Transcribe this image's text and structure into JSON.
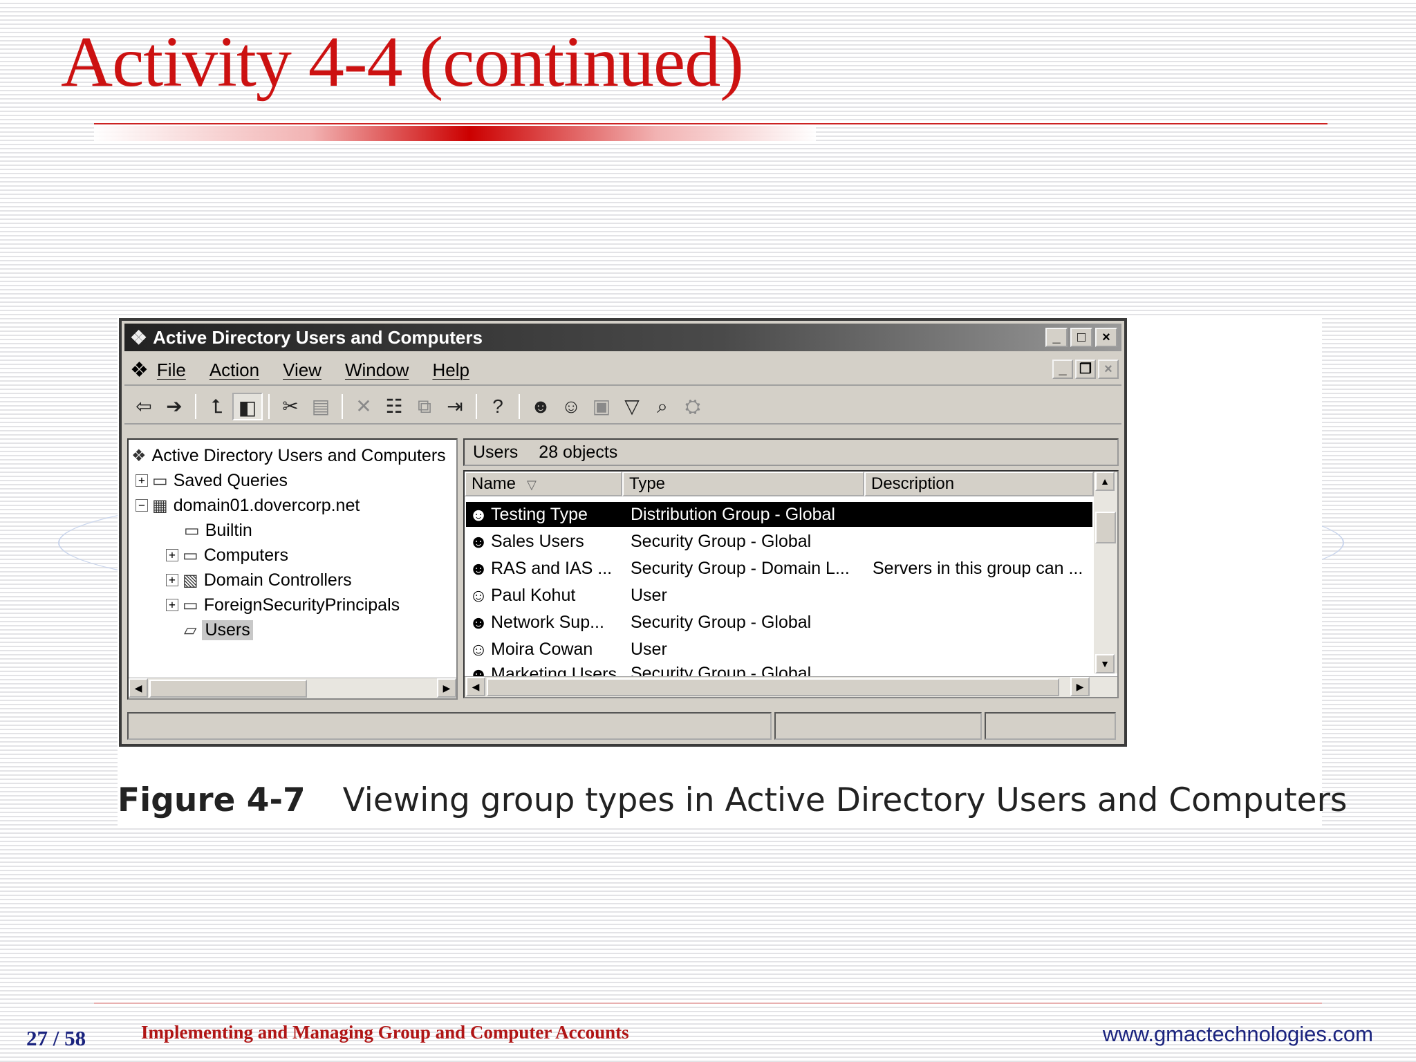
{
  "slide": {
    "title": "Activity 4-4 (continued)",
    "page_number": "27 / 58",
    "footer_title": "Implementing and Managing Group and Computer Accounts",
    "footer_url": "www.gmactechnologies.com",
    "caption_number": "Figure 4-7",
    "caption_text": "Viewing group types in Active Directory Users and Computers",
    "accent_color": "#cc1111"
  },
  "window": {
    "title": "Active Directory Users and Computers",
    "title_icon": "ad-tree-icon",
    "minimize_glyph": "_",
    "maximize_glyph": "□",
    "close_glyph": "×",
    "restore_glyph": "❐"
  },
  "menu": {
    "items": [
      "File",
      "Action",
      "View",
      "Window",
      "Help"
    ]
  },
  "toolbar": {
    "icons": [
      "back-arrow-icon",
      "forward-arrow-icon",
      "up-level-icon",
      "show-hide-tree-icon",
      "cut-icon",
      "paste-icon",
      "delete-icon",
      "properties-icon",
      "copy-icon",
      "export-list-icon",
      "help-icon",
      "new-user-icon",
      "new-group-icon",
      "new-ou-icon",
      "filter-icon",
      "find-icon",
      "add-to-group-icon"
    ]
  },
  "tree": {
    "root": "Active Directory Users and Computers",
    "saved_queries": "Saved Queries",
    "domain": "domain01.dovercorp.net",
    "builtin": "Builtin",
    "computers": "Computers",
    "domain_controllers": "Domain Controllers",
    "foreign": "ForeignSecurityPrincipals",
    "users": "Users",
    "expand_glyph": "+",
    "collapse_glyph": "−"
  },
  "list": {
    "container": "Users",
    "count": "28 objects",
    "columns": [
      "Name",
      "Type",
      "Description"
    ],
    "rows": [
      {
        "name": "Testing Type",
        "type": "Distribution Group - Global",
        "description": "",
        "icon": "group-icon",
        "selected": true
      },
      {
        "name": "Sales Users",
        "type": "Security Group - Global",
        "description": "",
        "icon": "group-icon"
      },
      {
        "name": "RAS and IAS ...",
        "type": "Security Group - Domain L...",
        "description": "Servers in this group can ...",
        "icon": "group-icon"
      },
      {
        "name": "Paul Kohut",
        "type": "User",
        "description": "",
        "icon": "user-icon"
      },
      {
        "name": "Network Sup...",
        "type": "Security Group - Global",
        "description": "",
        "icon": "group-icon"
      },
      {
        "name": "Moira Cowan",
        "type": "User",
        "description": "",
        "icon": "user-icon"
      },
      {
        "name": "Marketing Users",
        "type": "Security Group - Global",
        "description": "",
        "icon": "group-icon"
      }
    ]
  }
}
